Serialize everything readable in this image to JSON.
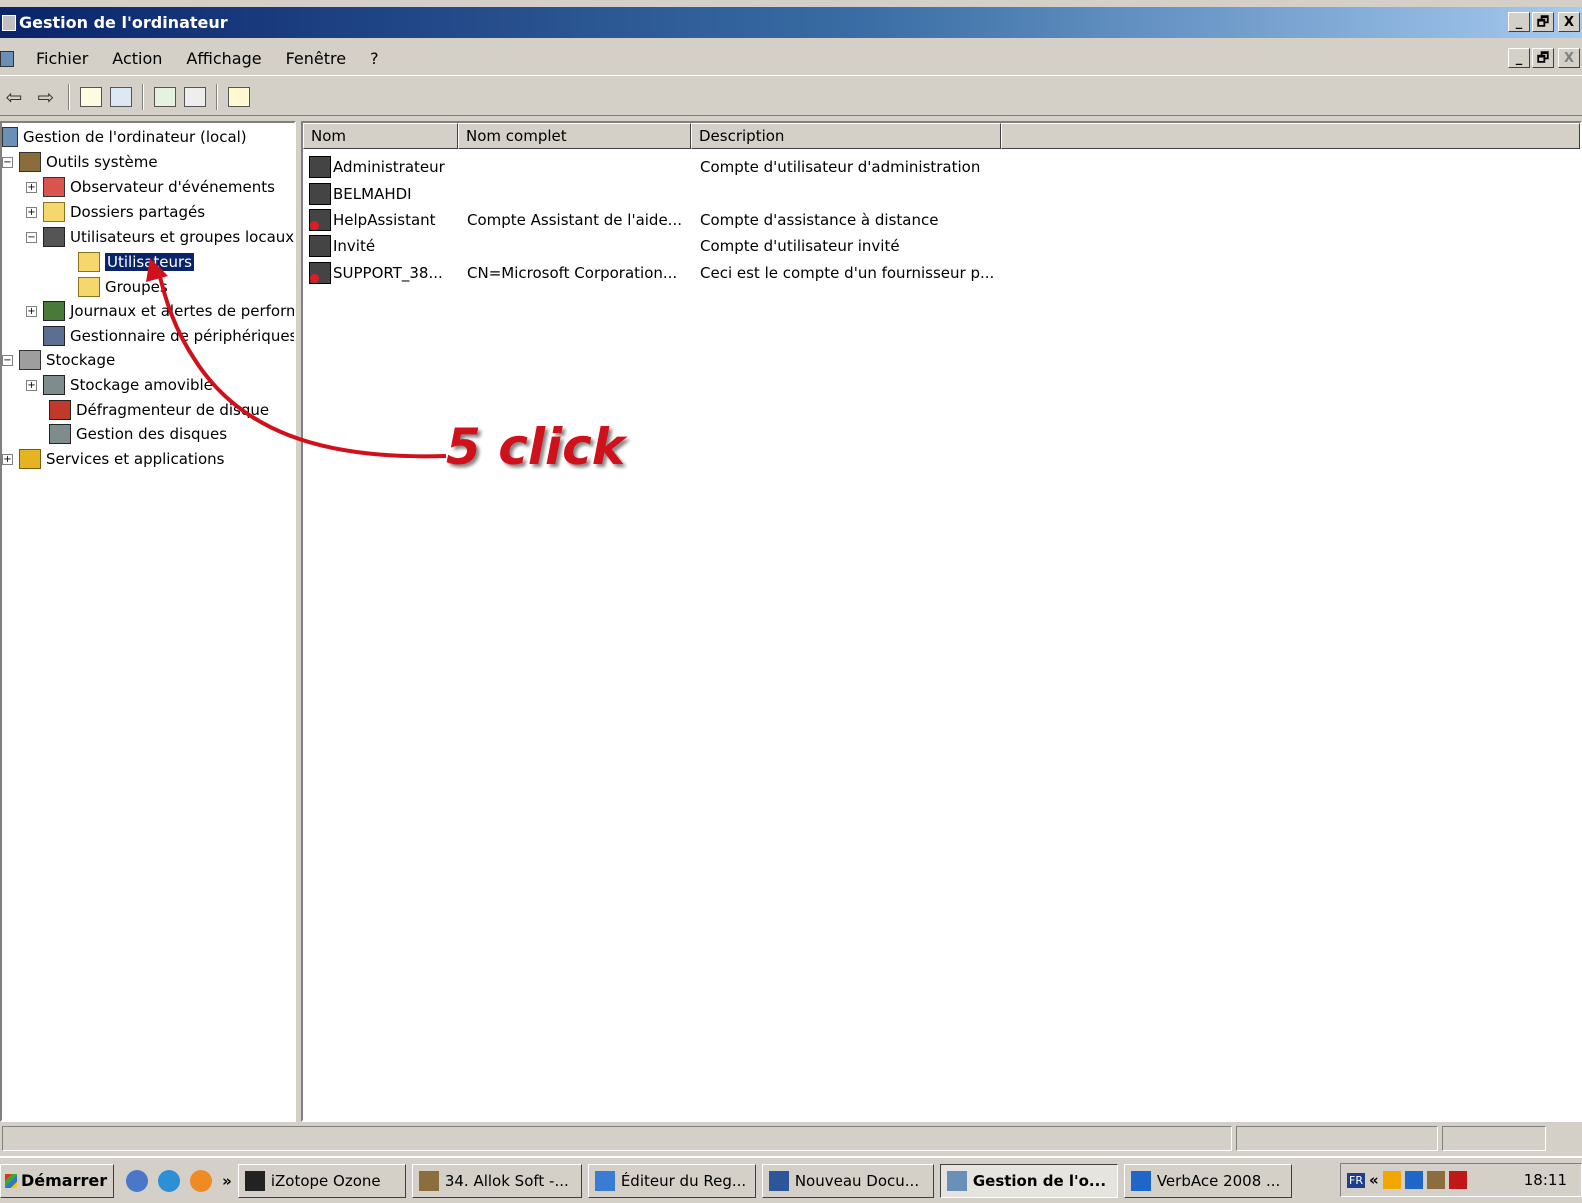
{
  "window": {
    "title": "Gestion de l'ordinateur",
    "buttons": {
      "minimize": "_",
      "maximize": "🗗",
      "close": "X"
    }
  },
  "menu": {
    "items": [
      "Fichier",
      "Action",
      "Affichage",
      "Fenêtre",
      "?"
    ]
  },
  "toolbar": {
    "back_icon": "back-arrow-icon",
    "forward_icon": "forward-arrow-icon"
  },
  "tree": {
    "root": "Gestion de l'ordinateur (local)",
    "nodes": [
      {
        "label": "Outils système"
      },
      {
        "label": "Observateur d'événements"
      },
      {
        "label": "Dossiers partagés"
      },
      {
        "label": "Utilisateurs et groupes locaux"
      },
      {
        "label": "Utilisateurs"
      },
      {
        "label": "Groupes"
      },
      {
        "label": "Journaux et alertes de performance"
      },
      {
        "label": "Gestionnaire de périphériques"
      },
      {
        "label": "Stockage"
      },
      {
        "label": "Stockage amovible"
      },
      {
        "label": "Défragmenteur de disque"
      },
      {
        "label": "Gestion des disques"
      },
      {
        "label": "Services et applications"
      }
    ],
    "selected": "Utilisateurs"
  },
  "list": {
    "columns": [
      "Nom",
      "Nom complet",
      "Description"
    ],
    "rows": [
      {
        "name": "Administrateur",
        "full_name": "",
        "description": "Compte d'utilisateur d'administration",
        "disabled": false
      },
      {
        "name": "BELMAHDI",
        "full_name": "",
        "description": "",
        "disabled": false
      },
      {
        "name": "HelpAssistant",
        "full_name": "Compte Assistant de l'aide...",
        "description": "Compte d'assistance à distance",
        "disabled": true
      },
      {
        "name": "Invité",
        "full_name": "",
        "description": "Compte d'utilisateur invité",
        "disabled": false
      },
      {
        "name": "SUPPORT_38...",
        "full_name": "CN=Microsoft Corporation...",
        "description": "Ceci est le compte d'un fournisseur p...",
        "disabled": true
      }
    ]
  },
  "annotation": {
    "text": "5 click",
    "color": "#d0101a"
  },
  "taskbar": {
    "start": "Démarrer",
    "more": "»",
    "tasks": [
      {
        "label": "iZotope Ozone",
        "active": false
      },
      {
        "label": "34. Allok Soft -...",
        "active": false
      },
      {
        "label": "Éditeur du Reg...",
        "active": false
      },
      {
        "label": "Nouveau Docu...",
        "active": false
      },
      {
        "label": "Gestion de l'o...",
        "active": true
      },
      {
        "label": "VerbAce 2008 ...",
        "active": false
      }
    ],
    "tray": {
      "lang": "FR",
      "chevron": "«",
      "clock": "18:11"
    }
  }
}
